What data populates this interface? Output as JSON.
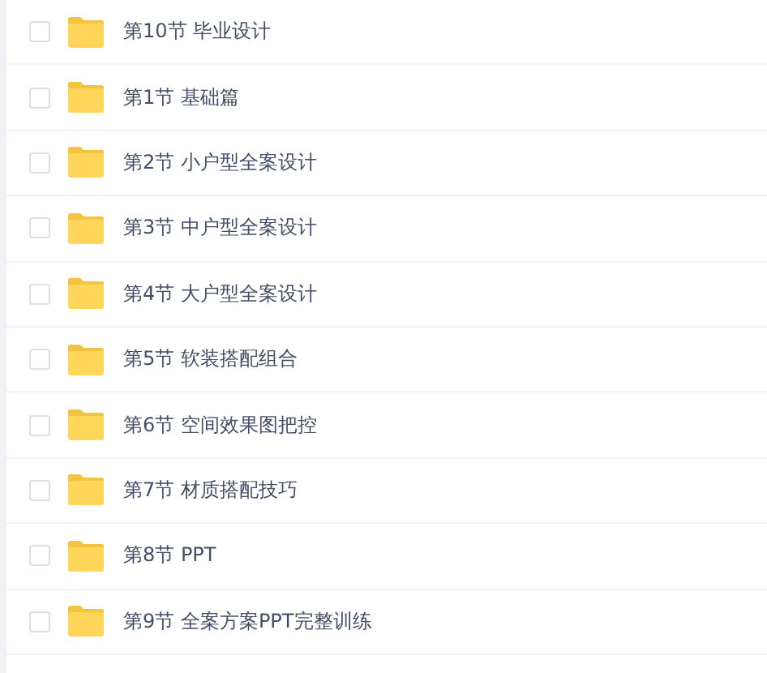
{
  "items": [
    {
      "label": "第10节 毕业设计",
      "checked": false
    },
    {
      "label": "第1节 基础篇",
      "checked": false
    },
    {
      "label": "第2节 小户型全案设计",
      "checked": false
    },
    {
      "label": "第3节 中户型全案设计",
      "checked": false
    },
    {
      "label": "第4节 大户型全案设计",
      "checked": false
    },
    {
      "label": "第5节 软装搭配组合",
      "checked": false
    },
    {
      "label": "第6节 空间效果图把控",
      "checked": false
    },
    {
      "label": "第7节 材质搭配技巧",
      "checked": false
    },
    {
      "label": "第8节 PPT",
      "checked": false
    },
    {
      "label": "第9节 全案方案PPT完整训练",
      "checked": false
    }
  ]
}
